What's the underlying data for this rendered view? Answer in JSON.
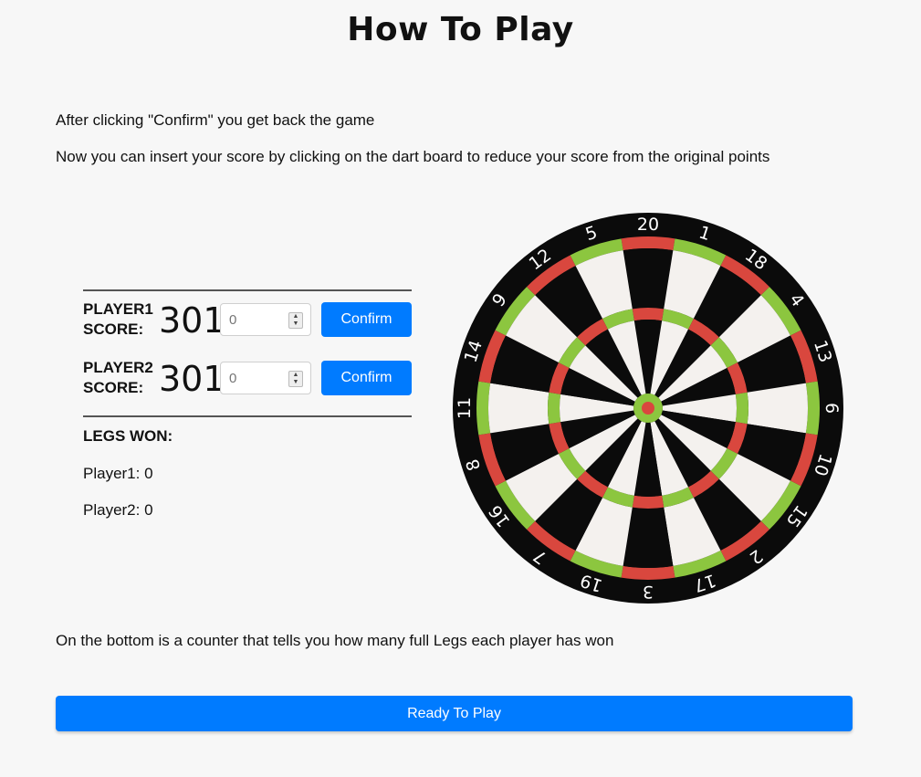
{
  "page": {
    "title": "How To Play",
    "paragraphs": [
      "After clicking \"Confirm\" you get back the game",
      "Now you can insert your score by clicking on the dart board to reduce your score from the original points",
      "On the bottom is a counter that tells you how many full Legs each player has won"
    ]
  },
  "scoreboard": {
    "players": [
      {
        "label_line1": "PLAYER1",
        "label_line2": "SCORE:",
        "score": "301",
        "input_placeholder": "0",
        "confirm_label": "Confirm"
      },
      {
        "label_line1": "PLAYER2",
        "label_line2": "SCORE:",
        "score": "301",
        "input_placeholder": "0",
        "confirm_label": "Confirm"
      }
    ],
    "legs_title": "LEGS WON:",
    "legs": [
      "Player1: 0",
      "Player2: 0"
    ]
  },
  "dartboard": {
    "numbers": [
      "20",
      "1",
      "18",
      "4",
      "13",
      "6",
      "10",
      "15",
      "2",
      "17",
      "3",
      "19",
      "7",
      "16",
      "8",
      "11",
      "14",
      "9",
      "12",
      "5"
    ],
    "colors": {
      "black": "#0b0b0b",
      "cream": "#f4f1ee",
      "red": "#d9473e",
      "green": "#8cc63f",
      "bull_red": "#d9473e",
      "number_color": "#ffffff"
    }
  },
  "footer": {
    "ready_label": "Ready To Play"
  },
  "colors": {
    "primary_button": "#007bff",
    "background": "#f7f7f7"
  }
}
